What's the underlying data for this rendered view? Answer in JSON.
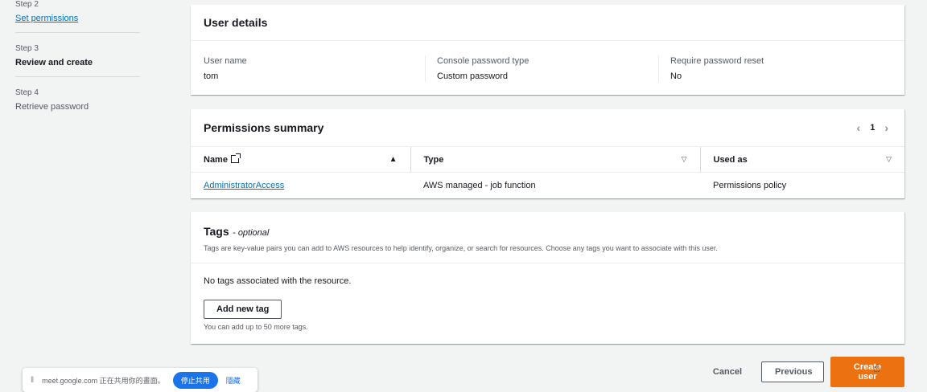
{
  "steps": [
    {
      "num": "Step 2",
      "label": "Set permissions"
    },
    {
      "num": "Step 3",
      "label": "Review and create"
    },
    {
      "num": "Step 4",
      "label": "Retrieve password"
    }
  ],
  "user_details": {
    "title": "User details",
    "fields": [
      {
        "label": "User name",
        "value": "tom"
      },
      {
        "label": "Console password type",
        "value": "Custom password"
      },
      {
        "label": "Require password reset",
        "value": "No"
      }
    ]
  },
  "permissions": {
    "title": "Permissions summary",
    "page": "1",
    "columns": [
      "Name",
      "Type",
      "Used as"
    ],
    "rows": [
      {
        "name": "AdministratorAccess",
        "type": "AWS managed - job function",
        "used_as": "Permissions policy"
      }
    ]
  },
  "tags": {
    "title": "Tags",
    "optional": "- optional",
    "description": "Tags are key-value pairs you can add to AWS resources to help identify, organize, or search for resources. Choose any tags you want to associate with this user.",
    "empty": "No tags associated with the resource.",
    "add_button": "Add new tag",
    "hint": "You can add up to 50 more tags."
  },
  "footer": {
    "cancel": "Cancel",
    "previous": "Previous",
    "create": "Create user"
  },
  "share_bar": {
    "text": "meet.google.com 正在共用你的畫面。",
    "stop": "停止共用",
    "hide": "隱藏"
  },
  "colors": {
    "primary": "#ec7211",
    "link": "#0073bb",
    "background": "#f2f3f3"
  }
}
